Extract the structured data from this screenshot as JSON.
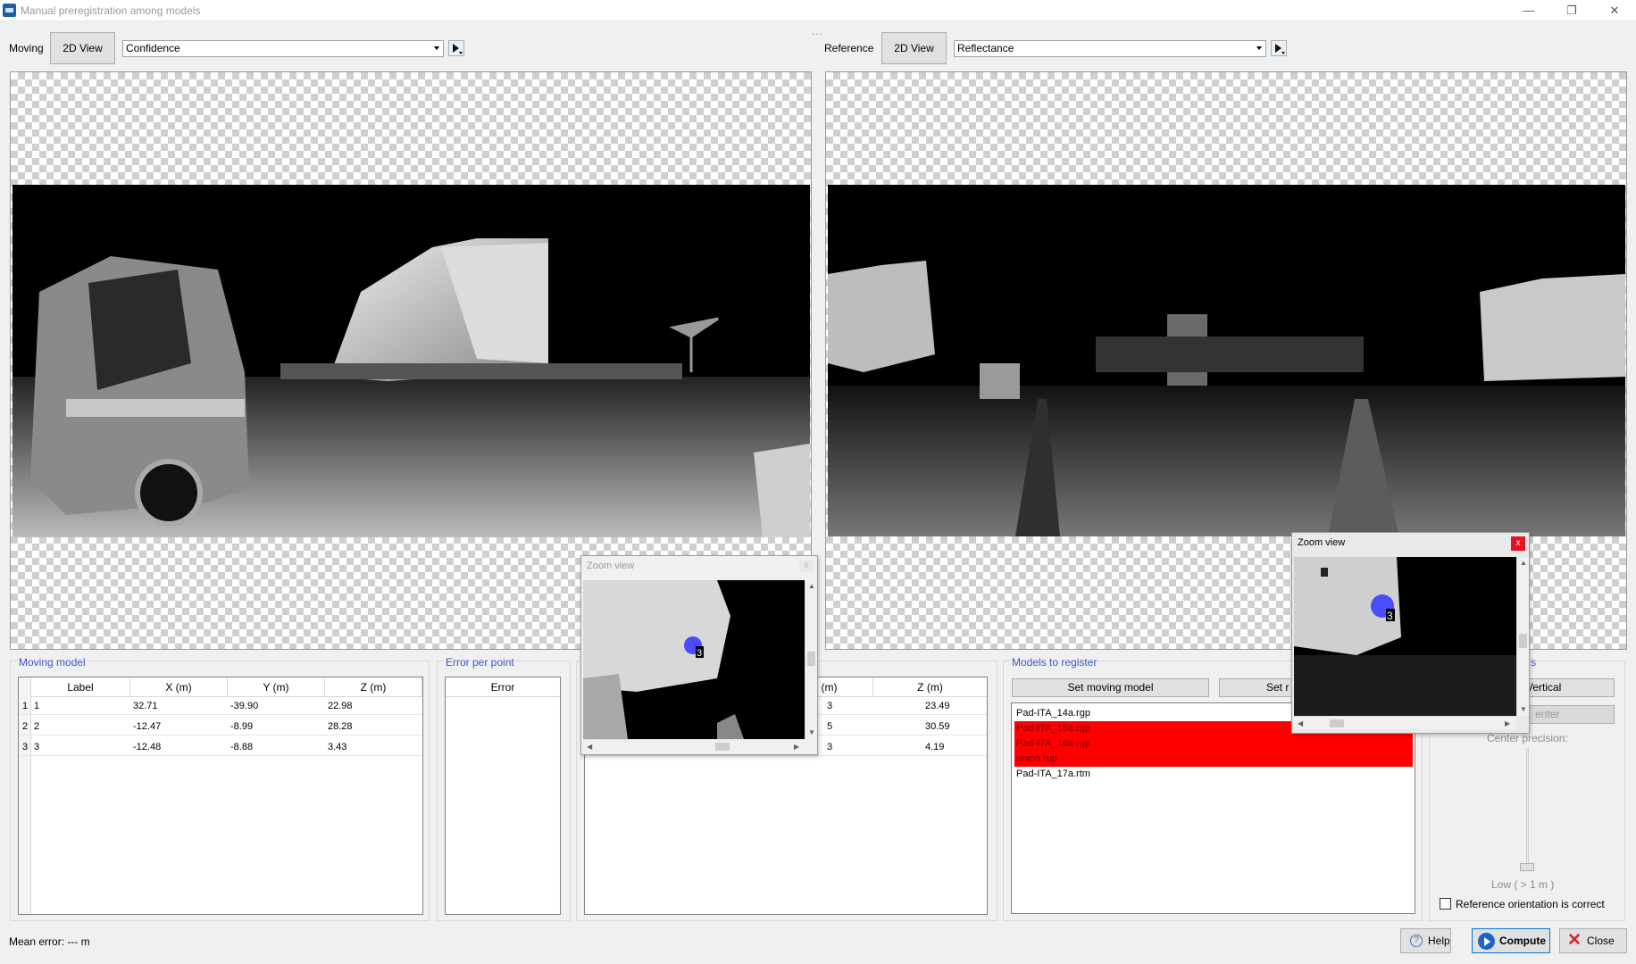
{
  "window": {
    "title": "Manual preregistration among models",
    "minimize": "—",
    "restore": "❐",
    "close": "✕"
  },
  "toolbar": {
    "moving_label": "Moving",
    "moving_view": "2D View",
    "moving_channel": "Confidence",
    "reference_label": "Reference",
    "reference_view": "2D View",
    "reference_channel": "Reflectance",
    "splitter": "..."
  },
  "moving_model": {
    "title": "Moving model",
    "columns": [
      "Label",
      "X (m)",
      "Y (m)",
      "Z (m)"
    ],
    "rows": [
      {
        "index": "1",
        "label": "1",
        "x": "32.71",
        "y": "-39.90",
        "z": "22.98"
      },
      {
        "index": "2",
        "label": "2",
        "x": "-12.47",
        "y": "-8.99",
        "z": "28.28"
      },
      {
        "index": "3",
        "label": "3",
        "x": "-12.48",
        "y": "-8.88",
        "z": "3.43"
      }
    ]
  },
  "error_per_point": {
    "title": "Error per point",
    "column": "Error"
  },
  "reference_model": {
    "columns": [
      "Y (m)",
      "Z (m)"
    ],
    "rows": [
      {
        "y_fragment": "3",
        "z": "23.49"
      },
      {
        "y_fragment": "5",
        "z": "30.59"
      },
      {
        "y_fragment": "3",
        "z": "4.19"
      }
    ]
  },
  "models_to_register": {
    "title": "Models to register",
    "set_moving_button": "Set moving model",
    "set_reference_button": "Set r",
    "items": [
      {
        "name": "Pad-ITA_14a.rgp",
        "state": "normal"
      },
      {
        "name": "Pad-ITA_15a.rgp",
        "state": "error"
      },
      {
        "name": "Pad-ITA_16a.rgp",
        "state": "error"
      },
      {
        "name": "union.rup",
        "state": "error"
      },
      {
        "name": "Pad-ITA_17a.rtm",
        "state": "normal"
      }
    ]
  },
  "options": {
    "title_fragment": "s",
    "vertical_button": "Vertical",
    "center_button": "enter",
    "center_precision_label": "Center precision:",
    "slider_level_label": "Low ( > 1 m )",
    "slider_value": 0,
    "reference_orientation_checkbox": "Reference orientation is correct",
    "reference_orientation_checked": false
  },
  "zoom_views": {
    "moving": {
      "title": "Zoom view",
      "point_label": "3",
      "close": "x"
    },
    "reference": {
      "title": "Zoom view",
      "point_label": "3",
      "close": "x"
    }
  },
  "status": {
    "mean_error": "Mean error: --- m"
  },
  "buttons": {
    "help": "Help",
    "compute": "Compute",
    "close": "Close"
  },
  "colors": {
    "group_title": "#3a55c9",
    "error_row": "#ff0000",
    "marker": "#4b4bff",
    "close_button": "#e81123"
  }
}
